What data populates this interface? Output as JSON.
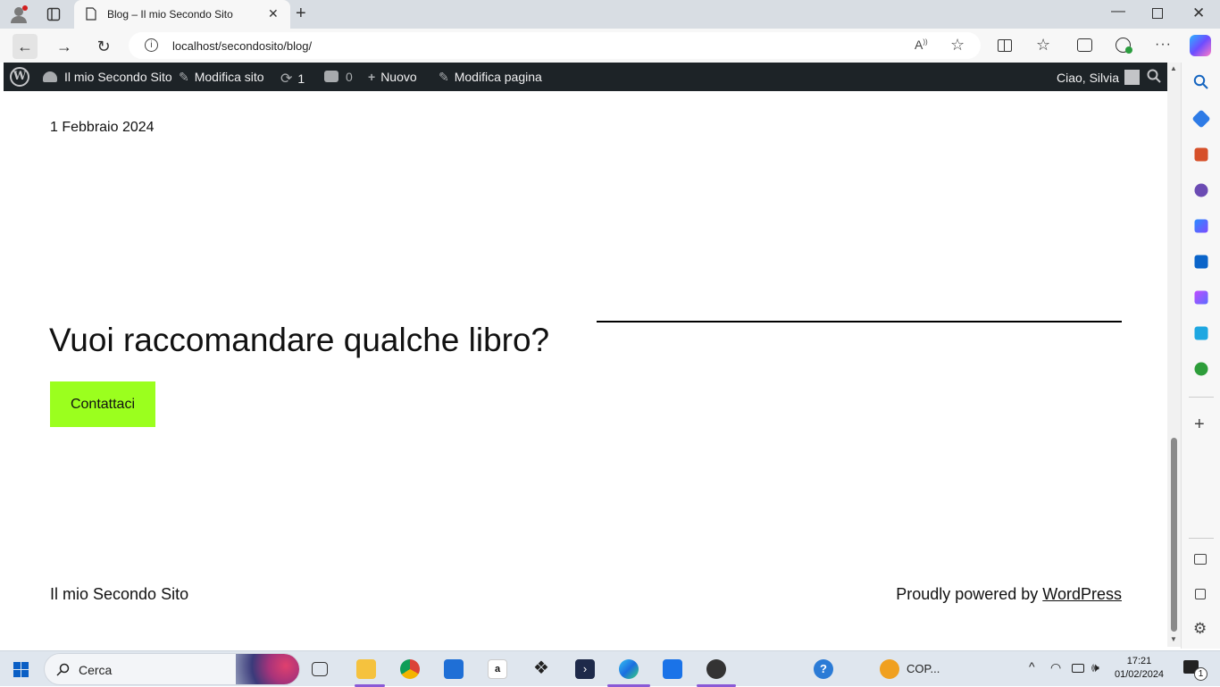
{
  "browser": {
    "tab_title": "Blog – Il mio Secondo Sito",
    "url": "localhost/secondosito/blog/"
  },
  "adminbar": {
    "site_name": "Il mio Secondo Sito",
    "edit_site": "Modifica sito",
    "updates_count": "1",
    "comments_count": "0",
    "new_label": "Nuovo",
    "edit_page": "Modifica pagina",
    "greeting": "Ciao, Silvia"
  },
  "page": {
    "post_date": "1 Febbraio 2024",
    "cta_heading": "Vuoi raccomandare qualche libro?",
    "cta_button": "Contattaci",
    "footer_site": "Il mio Secondo Sito",
    "footer_credit_prefix": "Proudly powered by ",
    "footer_credit_link": "WordPress"
  },
  "taskbar": {
    "search_label": "Cerca",
    "cop_label": "COP...",
    "time": "17:21",
    "date": "01/02/2024",
    "notification_count": "1"
  },
  "colors": {
    "accent_button": "#9bff1e",
    "admin_bar": "#1d2327"
  }
}
